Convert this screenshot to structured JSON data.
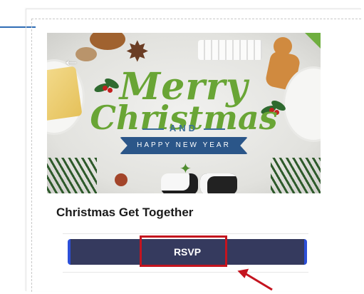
{
  "event": {
    "title": "Christmas Get Together",
    "banner": {
      "line1": "Merry",
      "line2": "Christmas",
      "and": "AND",
      "ribbon": "HAPPY NEW YEAR"
    }
  },
  "nav": {
    "back_icon": "back-arrow-icon"
  },
  "rsvp": {
    "label": "RSVP"
  },
  "colors": {
    "rsvp_bg": "#353a5e",
    "highlight": "#c4141f",
    "accent_blue": "#2c4fd8",
    "merry_green": "#69a535"
  }
}
